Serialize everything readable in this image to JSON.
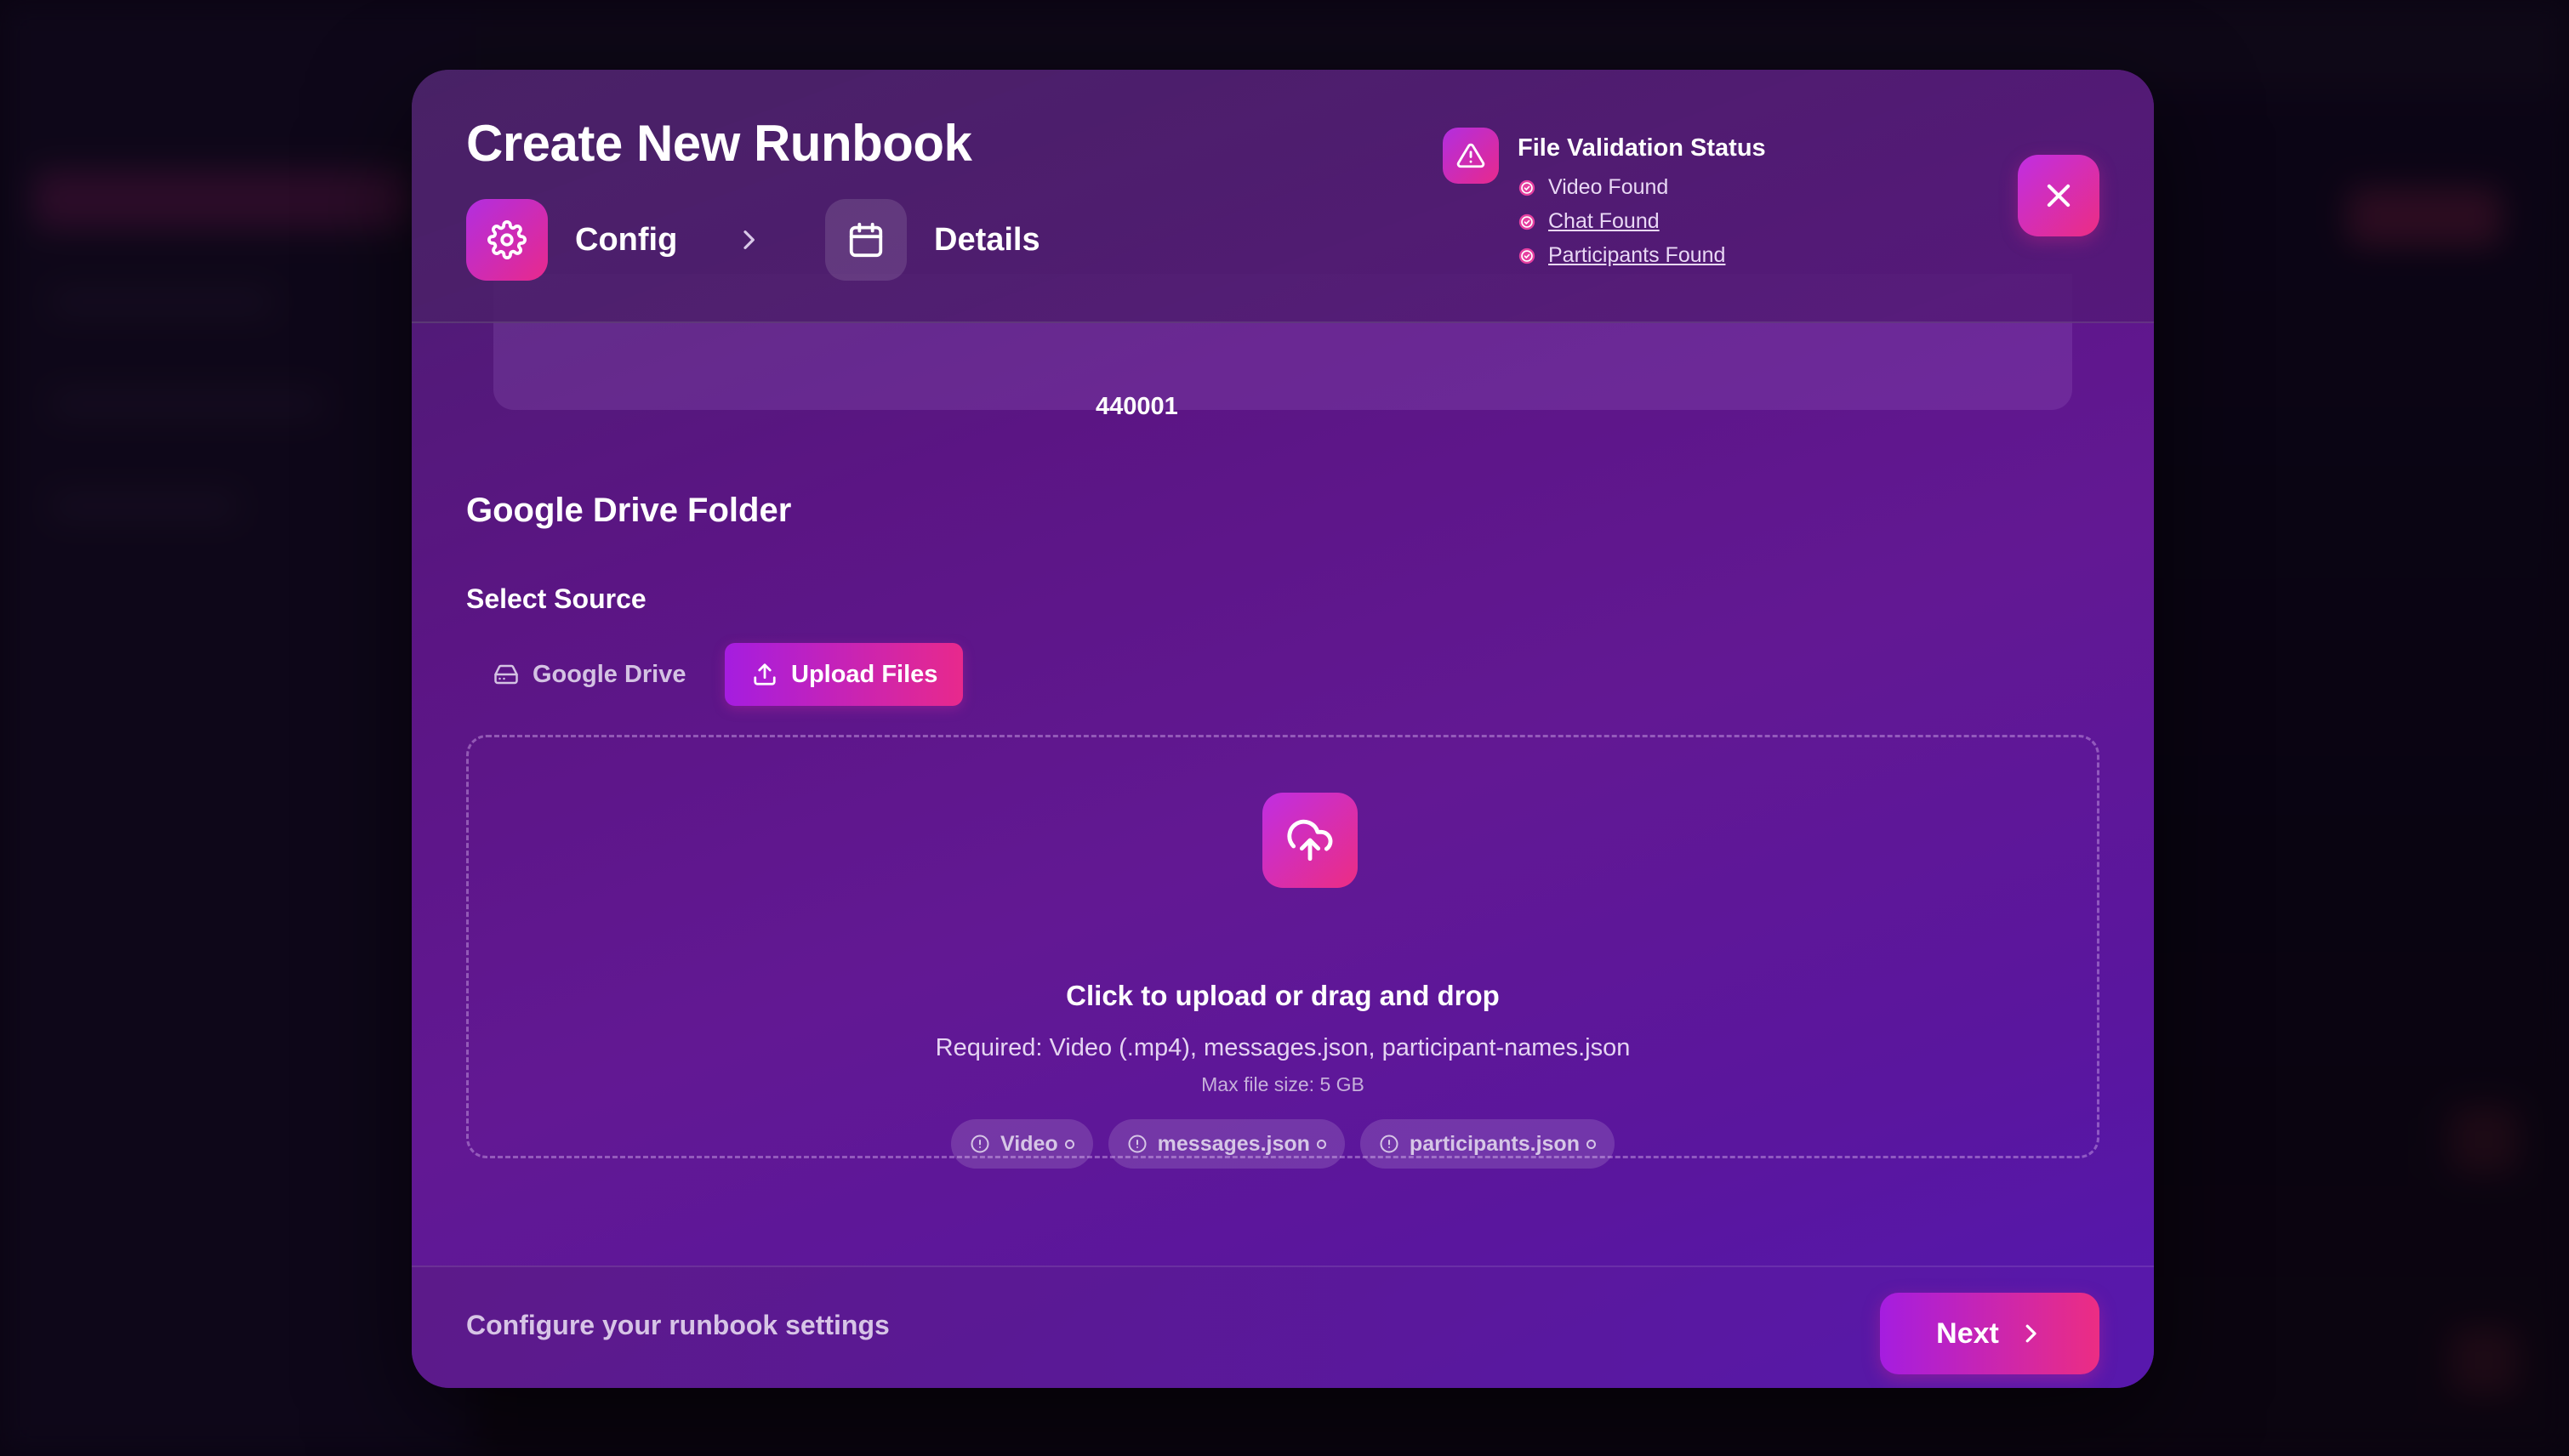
{
  "modal": {
    "title": "Create New Runbook",
    "steps": [
      {
        "label": "Config",
        "icon": "gear-icon",
        "state": "active"
      },
      {
        "label": "Details",
        "icon": "calendar-icon",
        "state": "inactive"
      }
    ],
    "close_icon": "close-icon"
  },
  "validation": {
    "title": "File Validation Status",
    "icon": "warning-triangle-icon",
    "items": [
      {
        "label": "Video Found",
        "link": false
      },
      {
        "label": "Chat Found",
        "link": true
      },
      {
        "label": "Participants Found",
        "link": true
      }
    ]
  },
  "scrolled_field": {
    "value": "440001"
  },
  "source": {
    "section_title": "Google Drive Folder",
    "select_label": "Select Source",
    "google_drive_label": "Google Drive",
    "upload_label": "Upload Files",
    "selected": "Upload Files"
  },
  "dropzone": {
    "title": "Click to upload or drag and drop",
    "required": "Required: Video (.mp4), messages.json, participant-names.json",
    "max_size": "Max file size: 5 GB",
    "chips": [
      {
        "label": "Video"
      },
      {
        "label": "messages.json"
      },
      {
        "label": "participants.json"
      }
    ]
  },
  "footer": {
    "hint": "Configure your runbook settings",
    "next_label": "Next"
  },
  "colors": {
    "accent_start": "#a51de0",
    "accent_end": "#ec2d83",
    "modal_bg": "#5b1584"
  }
}
